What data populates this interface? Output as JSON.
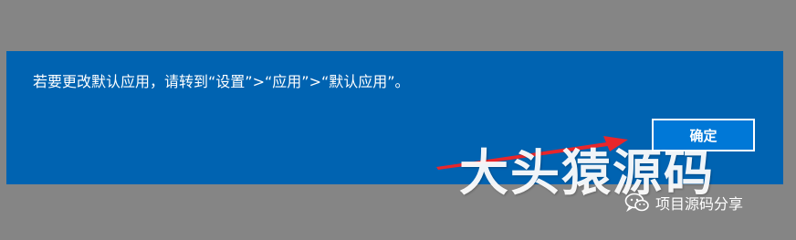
{
  "dialog": {
    "message": "若要更改默认应用，请转到“设置”>“应用”>“默认应用”。",
    "ok_label": "确定"
  },
  "annotation": {
    "arrow_color": "#e8262b"
  },
  "watermark": {
    "title": "大头猿源码",
    "subtitle": "项目源码分享",
    "icon": "wechat-icon"
  },
  "colors": {
    "background": "#858585",
    "dialog": "#0063b1",
    "button": "#0078d7",
    "text": "#ffffff"
  }
}
